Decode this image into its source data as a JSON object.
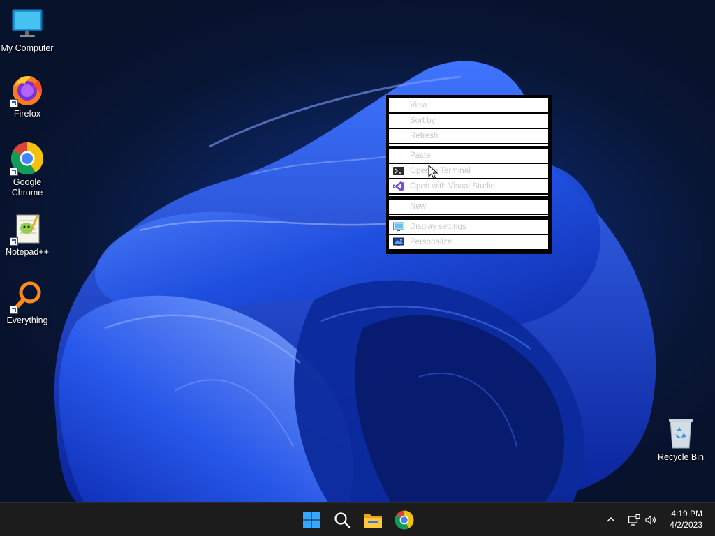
{
  "desktop": {
    "icons": [
      {
        "label": "My Computer"
      },
      {
        "label": "Firefox"
      },
      {
        "label": "Google Chrome"
      },
      {
        "label": "Notepad++"
      },
      {
        "label": "Everything"
      },
      {
        "label": "Recycle Bin"
      }
    ]
  },
  "context_menu": {
    "items": [
      {
        "label": "View"
      },
      {
        "label": "Sort by"
      },
      {
        "label": "Refresh"
      },
      {
        "label": "Paste"
      },
      {
        "label": "Open in Terminal"
      },
      {
        "label": "Open with Visual Studio"
      },
      {
        "label": "New"
      },
      {
        "label": "Display settings"
      },
      {
        "label": "Personalize"
      }
    ]
  },
  "taskbar": {
    "clock_time": "4:19 PM",
    "clock_date": "4/2/2023"
  },
  "icons": {
    "start": "windows-start-icon",
    "search": "search-icon",
    "explorer": "file-explorer-icon",
    "chrome": "chrome-icon",
    "tray": [
      "chevron-up-icon",
      "network-icon",
      "volume-icon"
    ]
  },
  "colors": {
    "wallpaper_accent": "#2c62f0",
    "taskbar_bg": "#1c1c1c",
    "menu_text": "#c9c9c9"
  }
}
